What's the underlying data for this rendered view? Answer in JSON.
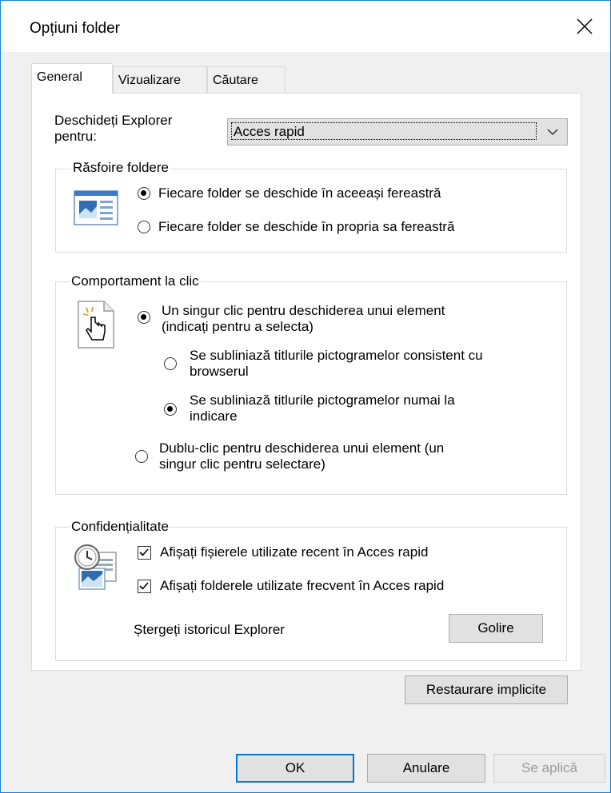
{
  "window": {
    "title": "Opțiuni folder"
  },
  "tabs": [
    "General",
    "Vizualizare",
    "Căutare"
  ],
  "open_explorer": {
    "label_line1": "Deschideți Explorer",
    "label_line2": "pentru:",
    "selected": "Acces rapid"
  },
  "browse_folders": {
    "legend": "Răsfoire foldere",
    "options": [
      {
        "label": "Fiecare folder se deschide în aceeași fereastră",
        "selected": true
      },
      {
        "label": "Fiecare folder se deschide în propria sa fereastră",
        "selected": false
      }
    ]
  },
  "click_behavior": {
    "legend": "Comportament la clic",
    "single_click": {
      "line1": "Un singur clic pentru deschiderea unui element",
      "line2": "(indicați pentru a selecta)",
      "selected": true
    },
    "underline_consistent": {
      "line1": "Se subliniază titlurile pictogramelor consistent cu",
      "line2": "browserul",
      "selected": false
    },
    "underline_hover": {
      "line1": "Se subliniază titlurile pictogramelor numai la",
      "line2": "indicare",
      "selected": true
    },
    "double_click": {
      "line1": "Dublu-clic pentru deschiderea unui element (un",
      "line2": "singur clic pentru selectare)",
      "selected": false
    }
  },
  "privacy": {
    "legend": "Confidențialitate",
    "show_recent_files": {
      "label": "Afișați fișierele utilizate recent în Acces rapid",
      "checked": true
    },
    "show_frequent_folders": {
      "label": "Afișați folderele utilizate frecvent în Acces rapid",
      "checked": true
    },
    "clear_history_label": "Ștergeți istoricul Explorer",
    "clear_button": "Golire"
  },
  "restore_defaults_button": "Restaurare implicite",
  "buttons": {
    "ok": "OK",
    "cancel": "Anulare",
    "apply": "Se aplică"
  },
  "colors": {
    "accent": "#0078d7",
    "window_border": "#1883d7"
  }
}
